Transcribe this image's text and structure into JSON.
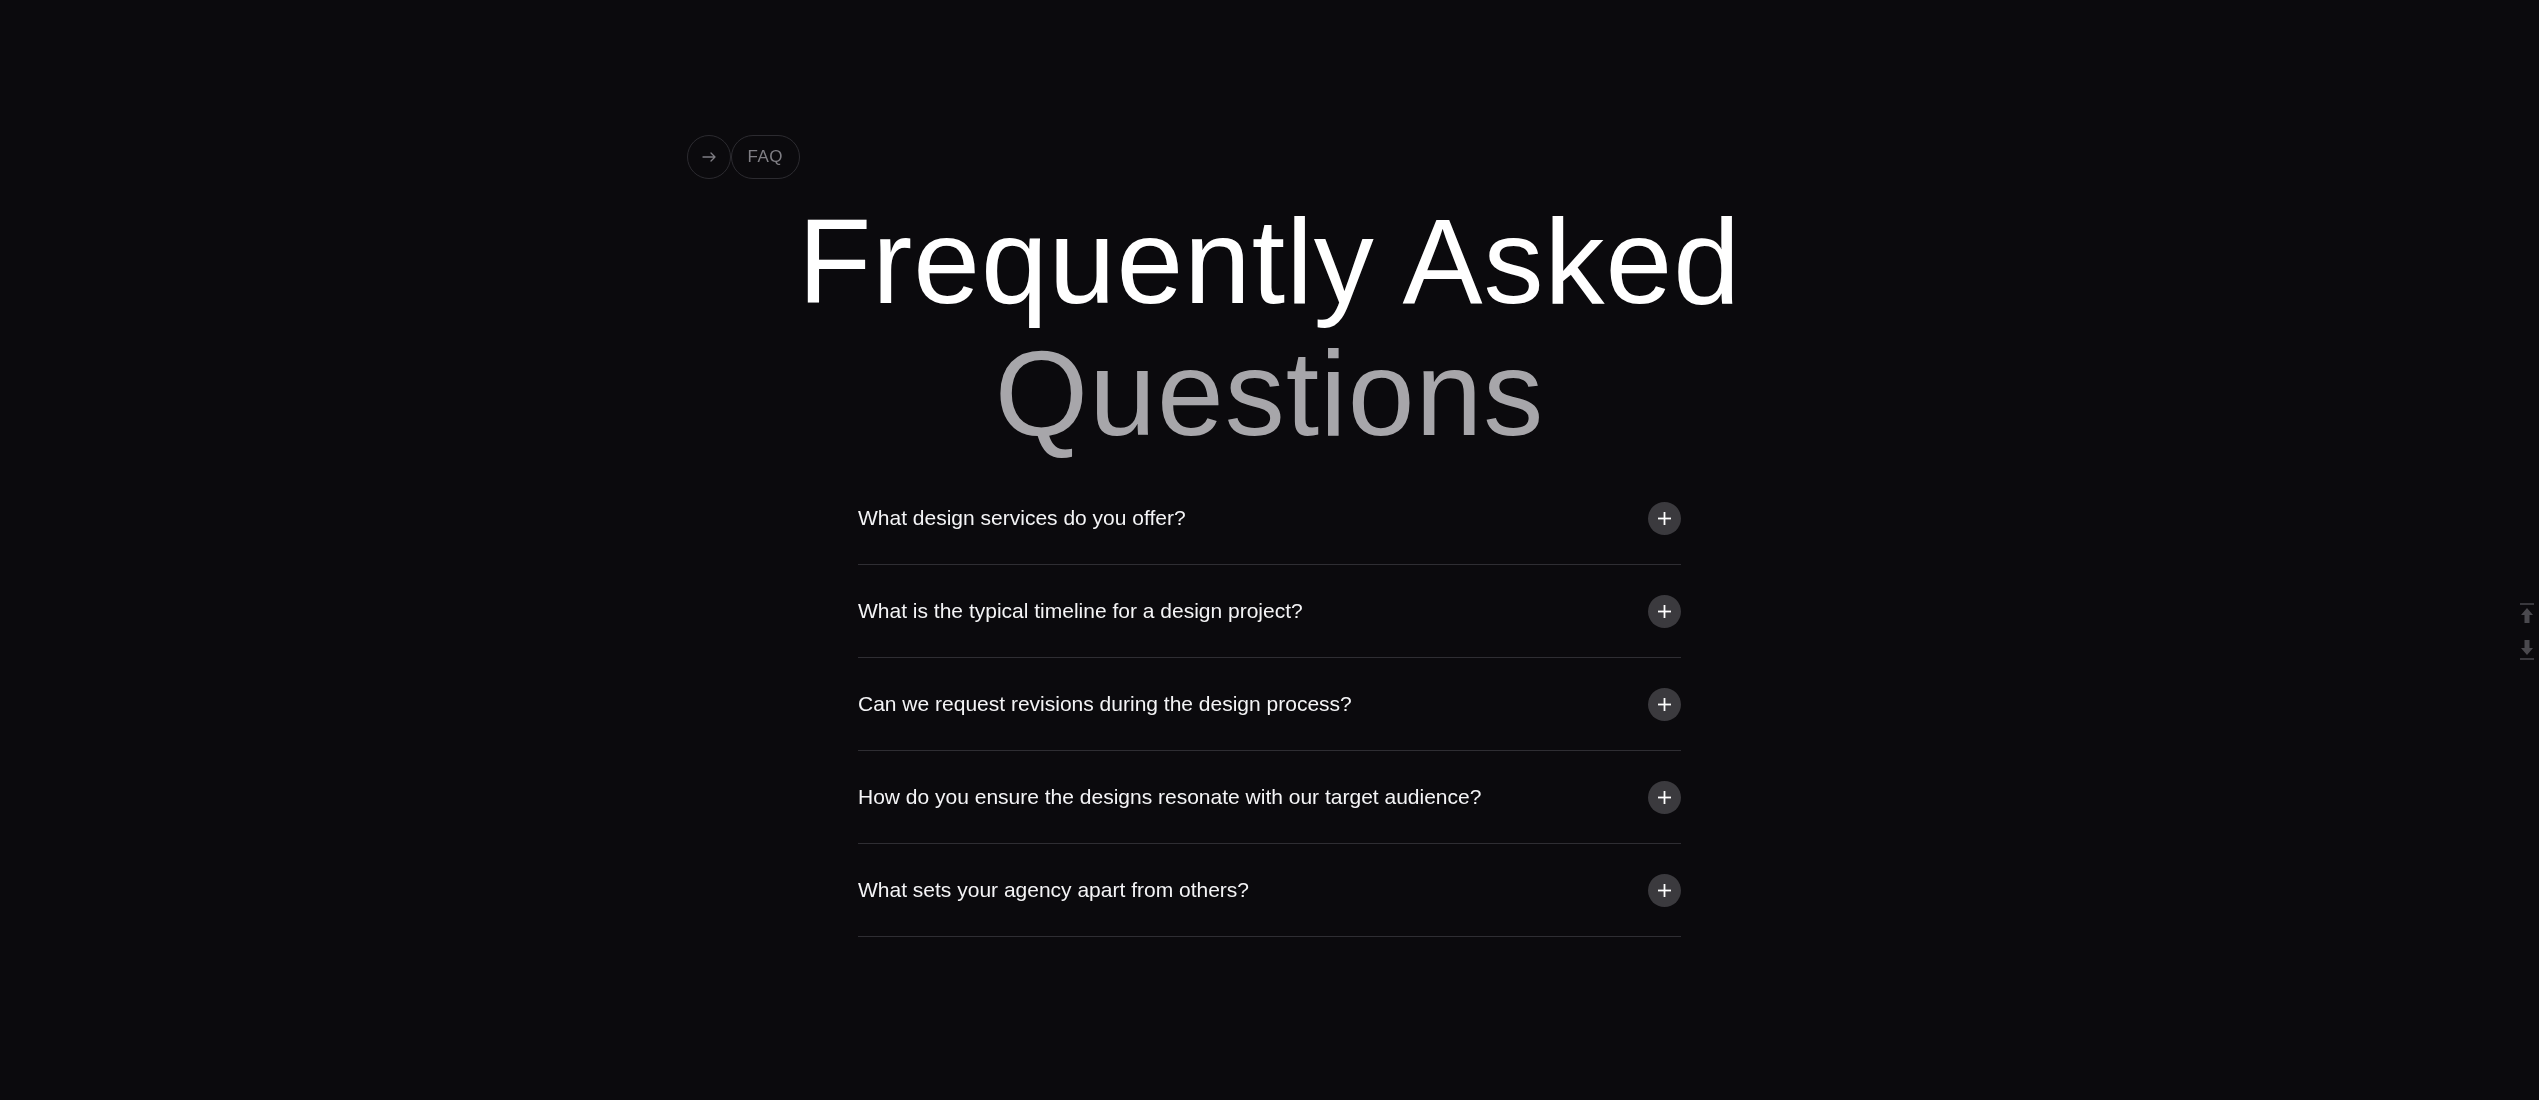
{
  "badge": {
    "label": "FAQ"
  },
  "heading": {
    "line_1": "Frequently Asked",
    "line_2": "Questions"
  },
  "faq_items": [
    {
      "question": "What design services do you offer?",
      "expanded": false
    },
    {
      "question": "What is the typical timeline for a design project?",
      "expanded": false
    },
    {
      "question": "Can we request revisions during the design process?",
      "expanded": false
    },
    {
      "question": "How do you ensure the designs resonate with our target audience?",
      "expanded": false
    },
    {
      "question": "What sets your agency apart from others?",
      "expanded": false
    }
  ]
}
